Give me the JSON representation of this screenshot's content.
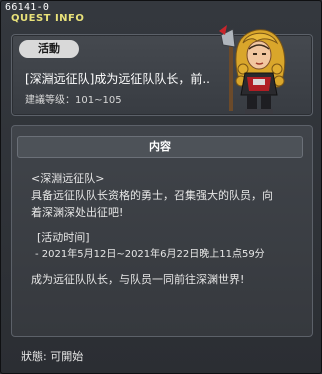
{
  "window": {
    "quest_id": "66141-0",
    "title": "QUEST INFO"
  },
  "quest": {
    "badge": "活動",
    "name": "[深淵远征队]成为远征队队长，前..",
    "level_label": "建議等级：101~105"
  },
  "content": {
    "header": "内容",
    "lines": [
      "<深淵远征队>",
      "具备远征队队长资格的勇士，召集强大的队员，向",
      "着深渊深处出征吧!",
      "[活动时间]",
      "- 2021年5月12日~2021年6月22日晚上11点59分",
      "成为远征队队长，与队员一同前往深渊世界!"
    ]
  },
  "status": {
    "text": "狀態: 可開始"
  },
  "colors": {
    "title": "#e9e27a",
    "badge_bg": "#d9d9d9",
    "panel_border": "#5c6169"
  }
}
